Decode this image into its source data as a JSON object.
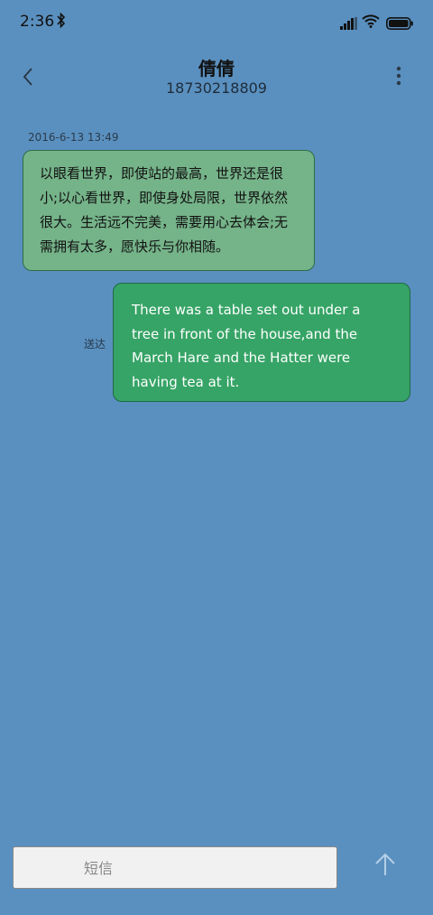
{
  "status_bar": {
    "time": "2:36",
    "icons": [
      "bluetooth-icon",
      "signal-icon",
      "wifi-icon",
      "battery-icon"
    ]
  },
  "header": {
    "contact_name": "倩倩",
    "phone_number": "18730218809",
    "icons": [
      "back-arrow-icon",
      "more-vertical-icon"
    ]
  },
  "conversation": {
    "timestamp": "2016-6-13 13:49",
    "messages": [
      {
        "direction": "incoming",
        "text": "以眼看世界，即使站的最高，世界还是很小;以心看世界，即使身处局限，世界依然很大。生活远不完美，需要用心去体会;无需拥有太多，愿快乐与你相随。"
      },
      {
        "direction": "outgoing",
        "status": "送达",
        "text": "There was a table set out under a tree in front of the house,and the March Hare and the Hatter were having tea at it."
      }
    ]
  },
  "composer": {
    "placeholder": "短信",
    "value": "",
    "send_icon": "send-arrow-up-icon"
  },
  "colors": {
    "background": "#5a90bf",
    "incoming_bubble": "#75b389",
    "outgoing_bubble": "#36a466"
  }
}
